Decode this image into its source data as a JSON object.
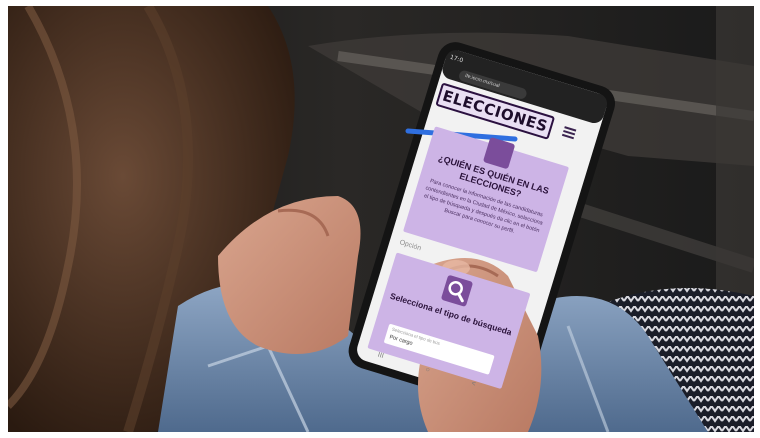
{
  "phone": {
    "status_time": "17:0",
    "url": "ife.iecm.mx/cual",
    "brand_title": "ELECCIONES",
    "card_title": "¿QUIÉN ES QUIÉN EN LAS ELECCIONES?",
    "card_body": "Para conocer la información de las candidaturas contendientes en la Ciudad de México, selecciona el tipo de búsqueda y después da clic en el botón Buscar para conocer su perfil.",
    "option_label": "Opción",
    "search_card_title": "Selecciona el tipo de búsqueda",
    "select_hint": "Selecciona el tipo de bús",
    "select_value": "Por cargo",
    "nav": [
      "III",
      "○",
      "<"
    ]
  },
  "colors": {
    "brand_purple": "#7b4d9b",
    "card_lilac": "#cdb4e6",
    "highlight_blue": "#2f6fe0"
  }
}
